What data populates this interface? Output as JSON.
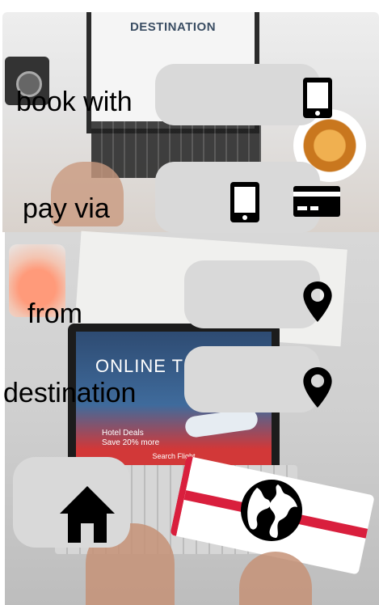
{
  "rows": {
    "book_with": {
      "label": "book with",
      "icon": "phone-icon"
    },
    "pay_via": {
      "label": "pay via",
      "icons": [
        "phone-icon",
        "credit-card-icon"
      ]
    },
    "from": {
      "label": "from",
      "icon": "location-pin-icon"
    },
    "destination": {
      "label": "destination",
      "icon": "location-pin-icon"
    }
  },
  "bottom_nav": {
    "home_icon": "home-icon",
    "globe_icon": "globe-icon"
  },
  "background": {
    "top_laptop_title": "DESTINATION",
    "screen_title": "ONLINE TIC",
    "screen_deal_line1": "Hotel Deals",
    "screen_deal_line2": "Save 20% more",
    "screen_button": "Search Flight"
  },
  "colors": {
    "pill": "#d9d9d9",
    "icon": "#000000",
    "ticket_red": "#d91f3d"
  }
}
